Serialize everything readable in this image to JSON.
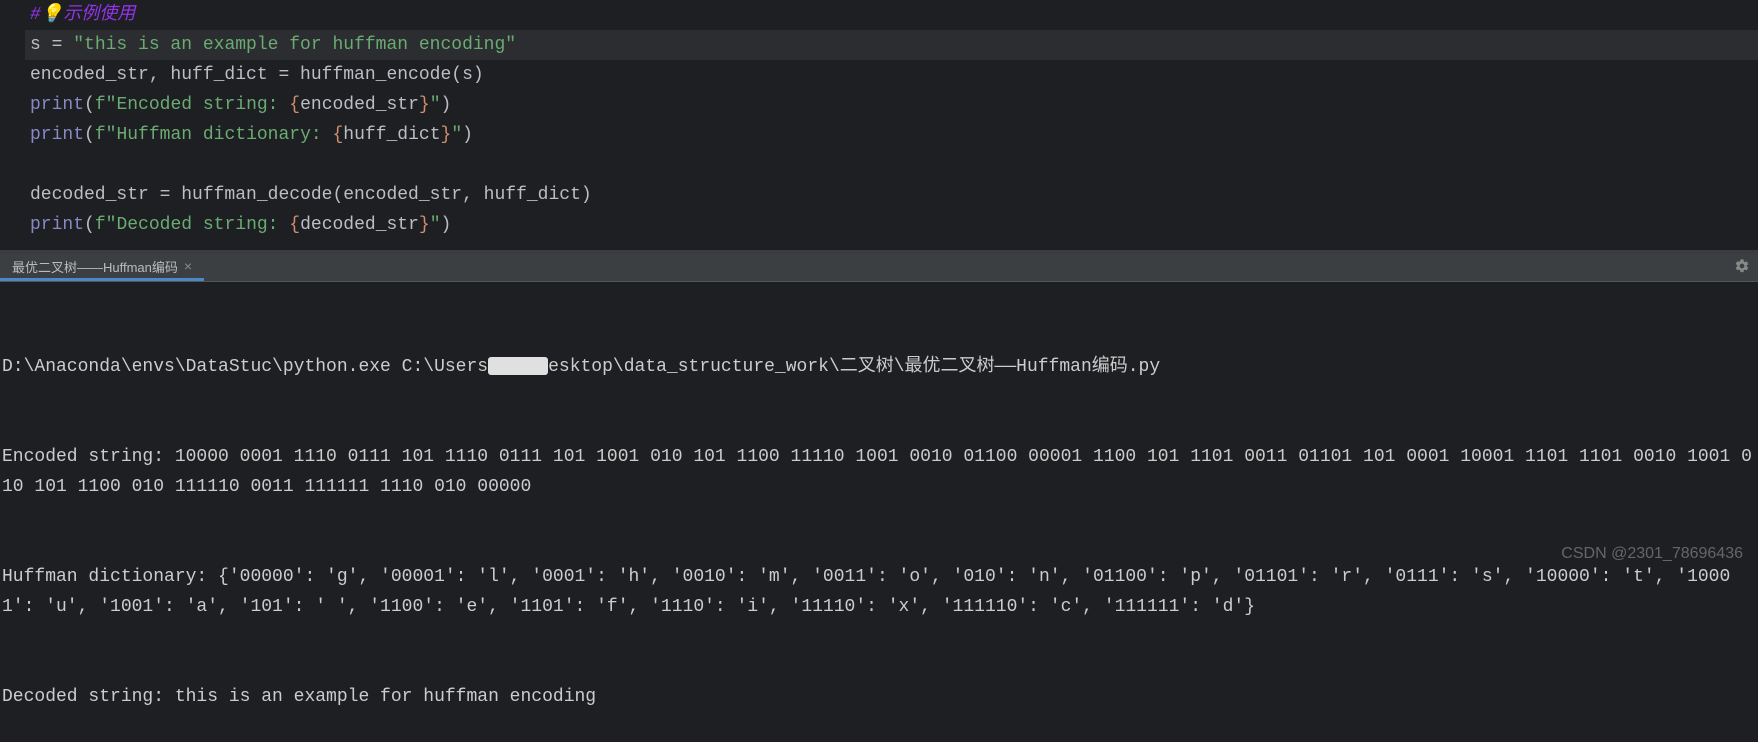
{
  "editor": {
    "comment_hash": "#",
    "comment_text": "示例使用",
    "line2_var": "s",
    "line2_eq": " = ",
    "line2_str": "\"this is an example for huffman encoding\"",
    "line3_full": "encoded_str, huff_dict = huffman_encode(s)",
    "line4_print": "print",
    "line4_open": "(",
    "line4_f": "f",
    "line4_str1": "\"Encoded string: ",
    "line4_brace_open": "{",
    "line4_var": "encoded_str",
    "line4_brace_close": "}",
    "line4_str2": "\"",
    "line4_close": ")",
    "line5_print": "print",
    "line5_open": "(",
    "line5_f": "f",
    "line5_str1": "\"Huffman dictionary: ",
    "line5_brace_open": "{",
    "line5_var": "huff_dict",
    "line5_brace_close": "}",
    "line5_str2": "\"",
    "line5_close": ")",
    "line7_full": "decoded_str = huffman_decode(encoded_str, huff_dict)",
    "line8_print": "print",
    "line8_open": "(",
    "line8_f": "f",
    "line8_str1": "\"Decoded string: ",
    "line8_brace_open": "{",
    "line8_var": "decoded_str",
    "line8_brace_close": "}",
    "line8_str2": "\"",
    "line8_close": ")"
  },
  "terminal": {
    "tab_title": "最优二叉树——Huffman编码",
    "tab_close": "×",
    "cmd_part1": "D:\\Anaconda\\envs\\DataStuc\\python.exe C:\\Users",
    "cmd_part2": "esktop\\data_structure_work\\二叉树\\最优二叉树——Huffman编码.py",
    "out1": "Encoded string: 10000 0001 1110 0111 101 1110 0111 101 1001 010 101 1100 11110 1001 0010 01100 00001 1100 101 1101 0011 01101 101 0001 10001 1101 1101 0010 1001 010 101 1100 010 111110 0011 111111 1110 010 00000",
    "out2": "Huffman dictionary: {'00000': 'g', '00001': 'l', '0001': 'h', '0010': 'm', '0011': 'o', '010': 'n', '01100': 'p', '01101': 'r', '0111': 's', '10000': 't', '10001': 'u', '1001': 'a', '101': ' ', '1100': 'e', '1101': 'f', '1110': 'i', '11110': 'x', '111110': 'c', '111111': 'd'}",
    "out3": "Decoded string: this is an example for huffman encoding"
  },
  "watermark": "CSDN @2301_78696436"
}
